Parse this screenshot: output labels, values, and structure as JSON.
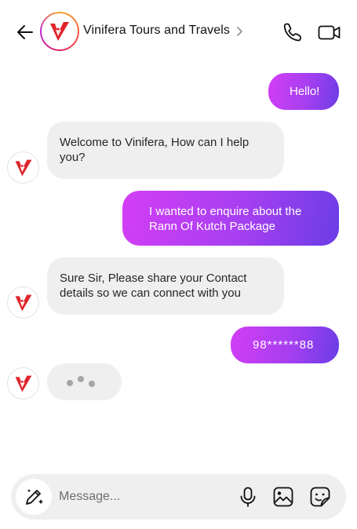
{
  "header": {
    "title": "Vinifera Tours and Travels",
    "icons": [
      "back-arrow-icon",
      "chevron-right-icon",
      "phone-icon",
      "video-camera-icon"
    ],
    "brand_color": "#e0242b"
  },
  "messages": [
    {
      "from": "me",
      "lines": [
        "Hello!"
      ]
    },
    {
      "from": "them",
      "lines": [
        "Welcome to Vinifera, How can I help",
        "you?"
      ]
    },
    {
      "from": "me",
      "lines": [
        "I wanted to enquire about the",
        "Rann Of Kutch Package"
      ]
    },
    {
      "from": "them",
      "lines": [
        "Sure Sir, Please share your Contact",
        "details so we can connect with you"
      ]
    },
    {
      "from": "me",
      "lines": [
        "98******88"
      ]
    }
  ],
  "typing_indicator": true,
  "composer": {
    "placeholder": "Message...",
    "icons": [
      "pencil-sparkle-icon",
      "microphone-icon",
      "image-icon",
      "sticker-icon"
    ]
  },
  "colors": {
    "outgoing_gradient_start": "#d33ef6",
    "outgoing_gradient_end": "#6b3de6",
    "incoming_bubble": "#efefef"
  }
}
